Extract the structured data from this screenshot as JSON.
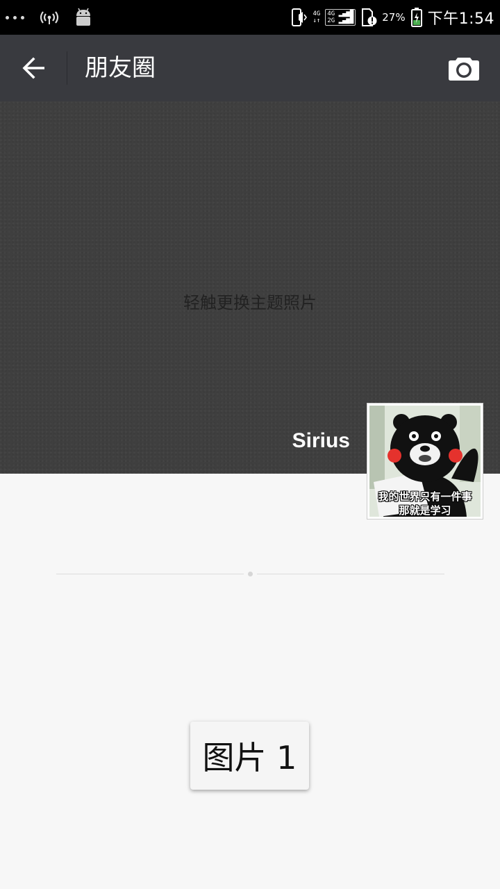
{
  "status_bar": {
    "network_small": "4G",
    "network_box": [
      "4G",
      "2G"
    ],
    "battery": "27%",
    "time": "下午1:54",
    "icons": [
      "more-dots-icon",
      "wifi-hotspot-icon",
      "android-icon",
      "vibrate-icon",
      "data-arrows-icon",
      "signal-icon",
      "sim-alert-icon",
      "battery-charging-icon"
    ]
  },
  "app_bar": {
    "title": "朋友圈",
    "back_icon": "arrow-left-icon",
    "camera_icon": "camera-icon"
  },
  "cover": {
    "hint": "轻触更换主题照片",
    "username": "Sirius"
  },
  "avatar": {
    "caption_line1": "我的世界只有一件事",
    "caption_line2": "那就是学习"
  },
  "image_label": "图片 1",
  "colors": {
    "status_bar": "#000000",
    "app_bar": "#393a3f",
    "cover": "#3f3f3f",
    "background": "#f7f7f7"
  }
}
